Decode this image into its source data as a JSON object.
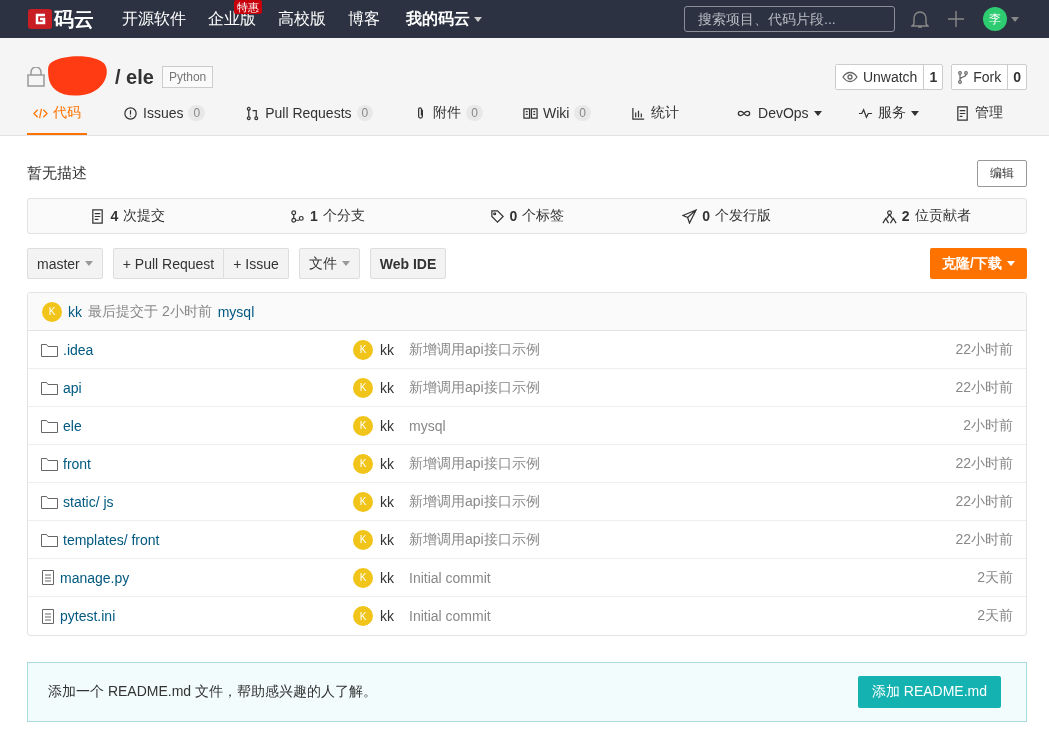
{
  "navbar": {
    "logo_text": "码云",
    "links": [
      {
        "label": "开源软件"
      },
      {
        "label": "企业版",
        "badge": "特惠"
      },
      {
        "label": "高校版"
      },
      {
        "label": "博客"
      }
    ],
    "my_menu": "我的码云",
    "search": {
      "placeholder": "搜索项目、代码片段..."
    },
    "user_avatar": "李"
  },
  "project": {
    "name": "/ ele",
    "language": "Python",
    "watch": {
      "label": "Unwatch",
      "count": "1"
    },
    "fork": {
      "label": "Fork",
      "count": "0"
    }
  },
  "tabs": [
    {
      "kind": "code",
      "label": "代码",
      "dropdown": false,
      "selected": true
    },
    {
      "kind": "issue",
      "label": "Issues",
      "count": "0",
      "dropdown": false,
      "selected": false
    },
    {
      "kind": "pr",
      "label": "Pull Requests",
      "count": "0",
      "dropdown": false,
      "selected": false
    },
    {
      "kind": "attach",
      "label": "附件",
      "count": "0",
      "dropdown": false,
      "selected": false
    },
    {
      "kind": "wiki",
      "label": "Wiki",
      "count": "0",
      "dropdown": false,
      "selected": false
    },
    {
      "kind": "stats",
      "label": "统计",
      "dropdown": false,
      "selected": false
    },
    {
      "kind": "devops",
      "label": "DevOps",
      "dropdown": true,
      "selected": false
    },
    {
      "kind": "service",
      "label": "服务",
      "dropdown": true,
      "selected": false
    },
    {
      "kind": "manage",
      "label": "管理",
      "dropdown": false,
      "selected": false
    }
  ],
  "description": "暂无描述",
  "edit_button": "编辑",
  "stats": [
    {
      "kind": "commits",
      "count": "4",
      "label": "次提交"
    },
    {
      "kind": "branches",
      "count": "1",
      "label": "个分支"
    },
    {
      "kind": "tags",
      "count": "0",
      "label": "个标签"
    },
    {
      "kind": "releases",
      "count": "0",
      "label": "个发行版"
    },
    {
      "kind": "contributors",
      "count": "2",
      "label": "位贡献者"
    }
  ],
  "toolbar": {
    "branch": "master",
    "pull_request": "+ Pull Request",
    "issue": "+ Issue",
    "file_menu": "文件",
    "web_ide": "Web IDE",
    "clone": "克隆/下载"
  },
  "last_commit": {
    "avatar": "K",
    "author": "kk",
    "text": "最后提交于",
    "time": "2小时前",
    "message": "mysql"
  },
  "files": [
    {
      "kind": "folder",
      "name": ".idea",
      "avatar": "K",
      "author": "kk",
      "message": "新增调用api接口示例",
      "time": "22小时前"
    },
    {
      "kind": "folder",
      "name": "api",
      "avatar": "K",
      "author": "kk",
      "message": "新增调用api接口示例",
      "time": "22小时前"
    },
    {
      "kind": "folder",
      "name": "ele",
      "avatar": "K",
      "author": "kk",
      "message": "mysql",
      "time": "2小时前"
    },
    {
      "kind": "folder",
      "name": "front",
      "avatar": "K",
      "author": "kk",
      "message": "新增调用api接口示例",
      "time": "22小时前"
    },
    {
      "kind": "folder",
      "name": "static/ js",
      "avatar": "K",
      "author": "kk",
      "message": "新增调用api接口示例",
      "time": "22小时前"
    },
    {
      "kind": "folder",
      "name": "templates/ front",
      "avatar": "K",
      "author": "kk",
      "message": "新增调用api接口示例",
      "time": "22小时前"
    },
    {
      "kind": "file",
      "name": "manage.py",
      "avatar": "K",
      "author": "kk",
      "message": "Initial commit",
      "time": "2天前"
    },
    {
      "kind": "file",
      "name": "pytest.ini",
      "avatar": "K",
      "author": "kk",
      "message": "Initial commit",
      "time": "2天前"
    }
  ],
  "readme_notice": {
    "text": "添加一个 README.md 文件，帮助感兴趣的人了解。",
    "button": "添加 README.md"
  }
}
